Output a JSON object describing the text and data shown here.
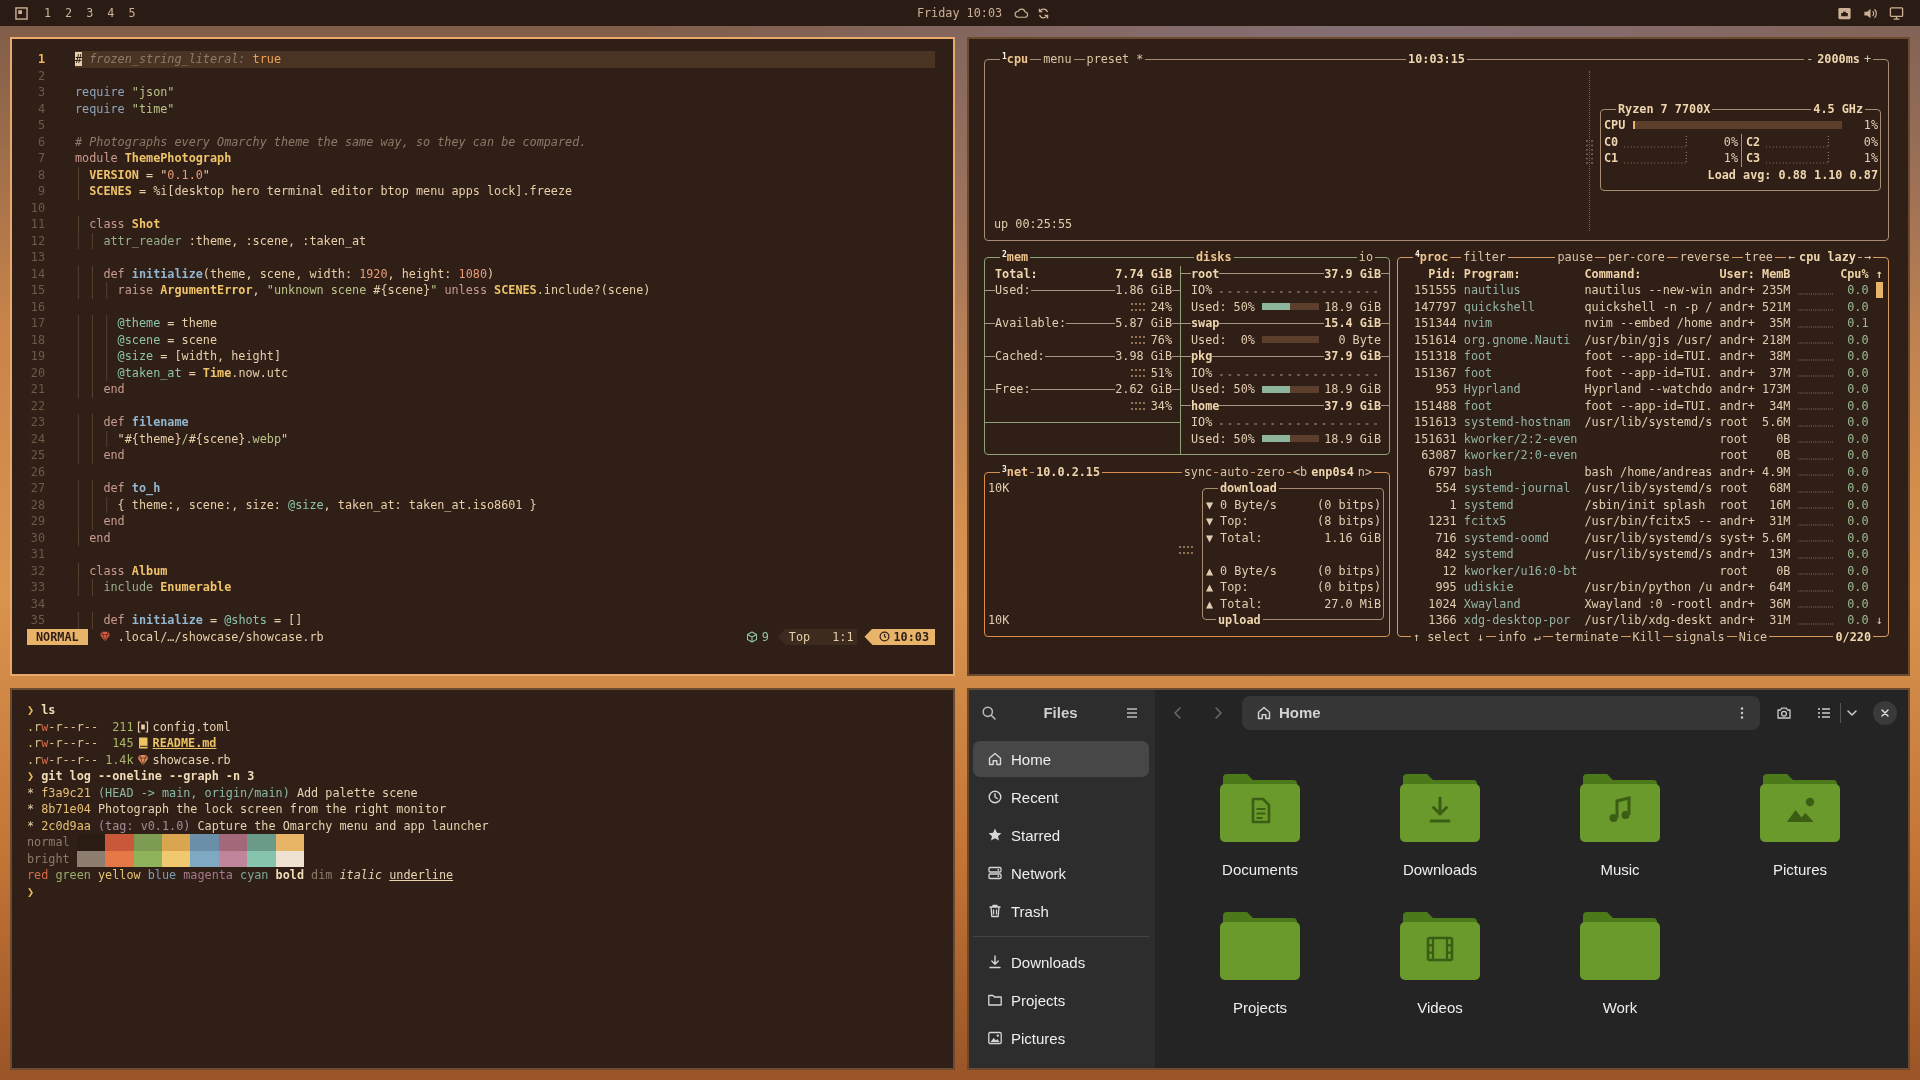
{
  "topbar": {
    "workspaces": [
      "1",
      "2",
      "3",
      "4",
      "5"
    ],
    "clock": "Friday 10:03"
  },
  "editor": {
    "active": true,
    "lines": [
      {
        "number": "1",
        "current": true,
        "tokens": [
          {
            "kind": "comment",
            "text": "# frozen_string_literal: "
          },
          {
            "kind": "boolean",
            "text": "true"
          }
        ]
      },
      {
        "number": "2",
        "current": false
      },
      {
        "number": "3",
        "current": false,
        "tokens": [
          {
            "kind": "builtin",
            "text": "require "
          },
          {
            "kind": "string",
            "text": "\"json\""
          }
        ]
      },
      {
        "number": "4",
        "current": false,
        "tokens": [
          {
            "kind": "builtin",
            "text": "require "
          },
          {
            "kind": "string",
            "text": "\"time\""
          }
        ]
      },
      {
        "number": "5",
        "current": false
      },
      {
        "number": "6",
        "current": false,
        "tokens": [
          {
            "kind": "comment",
            "text": "# Photographs every Omarchy theme the same way, so they can be compared."
          }
        ]
      },
      {
        "number": "7",
        "current": false,
        "tokens": [
          {
            "kind": "keyword",
            "text": "module "
          },
          {
            "kind": "constant",
            "text": "ThemePhotograph"
          }
        ]
      },
      {
        "number": "8",
        "current": false,
        "tokens": [
          {
            "kind": "constant",
            "text": "  VERSION"
          },
          {
            "kind": "plain",
            "text": " = \""
          },
          {
            "kind": "number",
            "text": "0.1.0"
          },
          {
            "kind": "plain",
            "text": "\""
          }
        ]
      },
      {
        "number": "9",
        "current": false,
        "tokens": [
          {
            "kind": "constant",
            "text": "  SCENES"
          },
          {
            "kind": "plain",
            "text": " = %i[desktop hero terminal editor btop menu apps lock].freeze"
          }
        ]
      },
      {
        "number": "10",
        "current": false
      },
      {
        "number": "11",
        "current": false,
        "tokens": [
          {
            "kind": "keyword",
            "text": "  class "
          },
          {
            "kind": "constant",
            "text": "Shot"
          }
        ]
      },
      {
        "number": "12",
        "current": false,
        "tokens": [
          {
            "kind": "macro",
            "text": "    attr_reader"
          },
          {
            "kind": "plain",
            "text": " :theme, :scene, :taken_at"
          }
        ]
      },
      {
        "number": "13",
        "current": false
      },
      {
        "number": "14",
        "current": false,
        "tokens": [
          {
            "kind": "keyword",
            "text": "    def "
          },
          {
            "kind": "function",
            "text": "initialize"
          },
          {
            "kind": "plain",
            "text": "(theme, scene, width: "
          },
          {
            "kind": "number",
            "text": "1920"
          },
          {
            "kind": "plain",
            "text": ", height: "
          },
          {
            "kind": "number",
            "text": "1080"
          },
          {
            "kind": "plain",
            "text": ")"
          }
        ]
      },
      {
        "number": "15",
        "current": false,
        "tokens": [
          {
            "kind": "keyword",
            "text": "      raise "
          },
          {
            "kind": "constant",
            "text": "ArgumentError"
          },
          {
            "kind": "plain",
            "text": ", "
          },
          {
            "kind": "string",
            "text": "\"unknown scene "
          },
          {
            "kind": "plain",
            "text": "#{scene}"
          },
          {
            "kind": "string",
            "text": "\""
          },
          {
            "kind": "keyword",
            "text": " unless "
          },
          {
            "kind": "constant",
            "text": "SCENES"
          },
          {
            "kind": "plain",
            "text": ".include?(scene)"
          }
        ]
      },
      {
        "number": "16",
        "current": false
      },
      {
        "number": "17",
        "current": false,
        "tokens": [
          {
            "kind": "ivar",
            "text": "      @theme"
          },
          {
            "kind": "plain",
            "text": " = theme"
          }
        ]
      },
      {
        "number": "18",
        "current": false,
        "tokens": [
          {
            "kind": "ivar",
            "text": "      @scene"
          },
          {
            "kind": "plain",
            "text": " = scene"
          }
        ]
      },
      {
        "number": "19",
        "current": false,
        "tokens": [
          {
            "kind": "ivar",
            "text": "      @size"
          },
          {
            "kind": "plain",
            "text": " = [width, height]"
          }
        ]
      },
      {
        "number": "20",
        "current": false,
        "tokens": [
          {
            "kind": "ivar",
            "text": "      @taken_at"
          },
          {
            "kind": "plain",
            "text": " = "
          },
          {
            "kind": "constant",
            "text": "Time"
          },
          {
            "kind": "plain",
            "text": ".now.utc"
          }
        ]
      },
      {
        "number": "21",
        "current": false,
        "tokens": [
          {
            "kind": "keyword",
            "text": "    end"
          }
        ]
      },
      {
        "number": "22",
        "current": false
      },
      {
        "number": "23",
        "current": false,
        "tokens": [
          {
            "kind": "keyword",
            "text": "    def "
          },
          {
            "kind": "function",
            "text": "filename"
          }
        ]
      },
      {
        "number": "24",
        "current": false,
        "tokens": [
          {
            "kind": "plain",
            "text": "      \"#{theme}"
          },
          {
            "kind": "string",
            "text": "/"
          },
          {
            "kind": "plain",
            "text": "#{scene}"
          },
          {
            "kind": "string",
            "text": ".webp"
          },
          {
            "kind": "plain",
            "text": "\""
          }
        ]
      },
      {
        "number": "25",
        "current": false,
        "tokens": [
          {
            "kind": "keyword",
            "text": "    end"
          }
        ]
      },
      {
        "number": "26",
        "current": false
      },
      {
        "number": "27",
        "current": false,
        "tokens": [
          {
            "kind": "keyword",
            "text": "    def "
          },
          {
            "kind": "function",
            "text": "to_h"
          }
        ]
      },
      {
        "number": "28",
        "current": false,
        "tokens": [
          {
            "kind": "plain",
            "text": "      { theme:, scene:, size: "
          },
          {
            "kind": "ivar",
            "text": "@size"
          },
          {
            "kind": "plain",
            "text": ", taken_at: taken_at.iso8601 }"
          }
        ]
      },
      {
        "number": "29",
        "current": false,
        "tokens": [
          {
            "kind": "keyword",
            "text": "    end"
          }
        ]
      },
      {
        "number": "30",
        "current": false,
        "tokens": [
          {
            "kind": "keyword",
            "text": "  end"
          }
        ]
      },
      {
        "number": "31",
        "current": false
      },
      {
        "number": "32",
        "current": false,
        "tokens": [
          {
            "kind": "keyword",
            "text": "  class "
          },
          {
            "kind": "constant",
            "text": "Album"
          }
        ]
      },
      {
        "number": "33",
        "current": false,
        "tokens": [
          {
            "kind": "macro",
            "text": "    include "
          },
          {
            "kind": "constant",
            "text": "Enumerable"
          }
        ]
      },
      {
        "number": "34",
        "current": false
      },
      {
        "number": "35",
        "current": false,
        "tokens": [
          {
            "kind": "keyword",
            "text": "    def "
          },
          {
            "kind": "function",
            "text": "initialize"
          },
          {
            "kind": "plain",
            "text": " = "
          },
          {
            "kind": "ivar",
            "text": "@shots"
          },
          {
            "kind": "plain",
            "text": " = []"
          }
        ]
      }
    ],
    "status": {
      "mode": "NORMAL",
      "path": ".local/…/showcase/showcase.rb",
      "diagnostics": "9",
      "scroll": "Top",
      "position": "1:1",
      "time": "10:03"
    }
  },
  "btop": {
    "active": false,
    "cpu": {
      "title": "$^{1}$cpu",
      "buttons": [
        "menu",
        "preset *"
      ],
      "clock": "10:03:15",
      "interval": {
        "decrease": "-",
        "value": "2000ms",
        "increase": "+"
      },
      "uptime": "up 00:25:55",
      "processor": {
        "name": "Ryzen 7 7700X",
        "frequency": "4.5 GHz",
        "total": {
          "label": "CPU",
          "level": 0.01,
          "reading": "1%"
        },
        "cores": [
          {
            "label": "C0",
            "reading": "0%"
          },
          {
            "label": "C2",
            "reading": "0%"
          },
          {
            "label": "C1",
            "reading": "1%"
          },
          {
            "label": "C3",
            "reading": "1%"
          }
        ],
        "load": "Load avg: 0.88 1.10 0.87"
      }
    },
    "memory": {
      "title": "$^{2}$mem",
      "rows": [
        {
          "kind": "total",
          "label": "Total:",
          "value": "7.74 GiB"
        },
        {
          "kind": "stat",
          "label": "Used:",
          "value": "1.86 GiB"
        },
        {
          "kind": "percent",
          "value": "24%"
        },
        {
          "kind": "stat",
          "label": "Available:",
          "value": "5.87 GiB"
        },
        {
          "kind": "percent",
          "value": "76%"
        },
        {
          "kind": "stat",
          "label": "Cached:",
          "value": "3.98 GiB"
        },
        {
          "kind": "percent",
          "value": "51%"
        },
        {
          "kind": "stat",
          "label": "Free:",
          "value": "2.62 GiB"
        },
        {
          "kind": "percent",
          "value": "34%"
        }
      ]
    },
    "disks": {
      "title": "disks",
      "io_title": "io",
      "drives": [
        {
          "name": "root",
          "size": "37.9 GiB",
          "io": "IO%",
          "used": "Used: 50%",
          "level": 0.5,
          "amount": "18.9 GiB"
        },
        {
          "name": "swap",
          "size": "15.4 GiB",
          "used": "Used:  0%",
          "amount": "0 Byte"
        },
        {
          "name": "pkg",
          "size": "37.9 GiB",
          "io": "IO%",
          "used": "Used: 50%",
          "level": 0.5,
          "amount": "18.9 GiB"
        },
        {
          "name": "home",
          "size": "37.9 GiB",
          "io": "IO%",
          "used": "Used: 50%",
          "level": 0.5,
          "amount": "18.9 GiB"
        }
      ]
    },
    "network": {
      "title": "$^{3}$net",
      "address": "10.0.2.15",
      "buttons": [
        "sync",
        "auto",
        "zero"
      ],
      "interface": {
        "previous": "<b",
        "name": "enp0s4",
        "next": "n>"
      },
      "scale": [
        "10K",
        "10K"
      ],
      "download": {
        "title": "download",
        "rows": [
          {
            "arrow": "▼",
            "label": "0 Byte/s",
            "value": "(0 bitps)"
          },
          {
            "arrow": "▼",
            "label": "Top:",
            "value": "(8 bitps)"
          },
          {
            "arrow": "▼",
            "label": "Total:",
            "value": "1.16 GiB"
          }
        ]
      },
      "upload": {
        "title": "upload",
        "rows": [
          {
            "arrow": "▲",
            "label": "0 Byte/s",
            "value": "(0 bitps)"
          },
          {
            "arrow": "▲",
            "label": "Top:",
            "value": "(0 bitps)"
          },
          {
            "arrow": "▲",
            "label": "Total:",
            "value": "27.0 MiB"
          }
        ]
      }
    },
    "processes": {
      "title": "$^{4}$proc",
      "filter": "filter",
      "toggles": [
        "pause",
        "per-core",
        "reverse",
        "tree"
      ],
      "sort": {
        "previous": "←",
        "name": "cpu lazy",
        "next": "→"
      },
      "columns": [
        "Pid:",
        "Program:",
        "Command:",
        "User:",
        "MemB",
        "Cpu%"
      ],
      "scroll_up": "↑",
      "scroll_down": "↓",
      "rows": [
        {
          "pid": "151555",
          "program": "nautilus",
          "command": "nautilus --new-win",
          "user": "andr+",
          "memory": "235M",
          "cpu": "0.0"
        },
        {
          "pid": "147797",
          "program": "quickshell",
          "command": "quickshell -n -p /",
          "user": "andr+",
          "memory": "521M",
          "cpu": "0.0"
        },
        {
          "pid": "151344",
          "program": "nvim",
          "command": "nvim --embed /home",
          "user": "andr+",
          "memory": "35M",
          "cpu": "0.1"
        },
        {
          "pid": "151614",
          "program": "org.gnome.Nauti",
          "command": "/usr/bin/gjs /usr/",
          "user": "andr+",
          "memory": "218M",
          "cpu": "0.0"
        },
        {
          "pid": "151318",
          "program": "foot",
          "command": "foot --app-id=TUI.",
          "user": "andr+",
          "memory": "38M",
          "cpu": "0.0"
        },
        {
          "pid": "151367",
          "program": "foot",
          "command": "foot --app-id=TUI.",
          "user": "andr+",
          "memory": "37M",
          "cpu": "0.0"
        },
        {
          "pid": "953",
          "program": "Hyprland",
          "command": "Hyprland --watchdo",
          "user": "andr+",
          "memory": "173M",
          "cpu": "0.0"
        },
        {
          "pid": "151488",
          "program": "foot",
          "command": "foot --app-id=TUI.",
          "user": "andr+",
          "memory": "34M",
          "cpu": "0.0"
        },
        {
          "pid": "151613",
          "program": "systemd-hostnam",
          "command": "/usr/lib/systemd/s",
          "user": "root",
          "memory": "5.6M",
          "cpu": "0.0"
        },
        {
          "pid": "151631",
          "program": "kworker/2:2-even",
          "user": "root",
          "memory": "0B",
          "cpu": "0.0"
        },
        {
          "pid": "63087",
          "program": "kworker/2:0-even",
          "user": "root",
          "memory": "0B",
          "cpu": "0.0"
        },
        {
          "pid": "6797",
          "program": "bash",
          "command": "bash /home/andreas",
          "user": "andr+",
          "memory": "4.9M",
          "cpu": "0.0"
        },
        {
          "pid": "554",
          "program": "systemd-journal",
          "command": "/usr/lib/systemd/s",
          "user": "root",
          "memory": "68M",
          "cpu": "0.0"
        },
        {
          "pid": "1",
          "program": "systemd",
          "command": "/sbin/init splash",
          "user": "root",
          "memory": "16M",
          "cpu": "0.0"
        },
        {
          "pid": "1231",
          "program": "fcitx5",
          "command": "/usr/bin/fcitx5 --",
          "user": "andr+",
          "memory": "31M",
          "cpu": "0.0"
        },
        {
          "pid": "716",
          "program": "systemd-oomd",
          "command": "/usr/lib/systemd/s",
          "user": "syst+",
          "memory": "5.6M",
          "cpu": "0.0"
        },
        {
          "pid": "842",
          "program": "systemd",
          "command": "/usr/lib/systemd/s",
          "user": "andr+",
          "memory": "13M",
          "cpu": "0.0"
        },
        {
          "pid": "12",
          "program": "kworker/u16:0-bt",
          "user": "root",
          "memory": "0B",
          "cpu": "0.0"
        },
        {
          "pid": "995",
          "program": "udiskie",
          "command": "/usr/bin/python /u",
          "user": "andr+",
          "memory": "64M",
          "cpu": "0.0"
        },
        {
          "pid": "1024",
          "program": "Xwayland",
          "command": "Xwayland :0 -rootl",
          "user": "andr+",
          "memory": "36M",
          "cpu": "0.0"
        },
        {
          "pid": "1366",
          "program": "xdg-desktop-por",
          "command": "/usr/lib/xdg-deskt",
          "user": "andr+",
          "memory": "31M",
          "cpu": "0.0"
        }
      ],
      "footer": [
        "↑ select ↓",
        "info ↵",
        "terminate",
        "Kill",
        "signals",
        "Nice"
      ],
      "count": "0/220"
    }
  },
  "terminal": {
    "active": false,
    "lines": [
      {
        "kind": "command",
        "prompt": "❯",
        "command": "ls"
      },
      {
        "kind": "file",
        "permissions": [
          {
            "kind": "plain",
            "text": ".r"
          },
          {
            "kind": "write",
            "text": "w"
          },
          {
            "kind": "plain",
            "text": "-r--r--"
          }
        ],
        "size": "211",
        "file": {
          "kind": "toml",
          "name": "config.toml",
          "highlighted": false
        }
      },
      {
        "kind": "file",
        "permissions": [
          {
            "kind": "plain",
            "text": ".r"
          },
          {
            "kind": "write",
            "text": "w"
          },
          {
            "kind": "plain",
            "text": "-r--r--"
          }
        ],
        "size": "145",
        "file": {
          "kind": "markdown",
          "name": "README.md",
          "highlighted": true
        }
      },
      {
        "kind": "file",
        "permissions": [
          {
            "kind": "plain",
            "text": ".r"
          },
          {
            "kind": "write",
            "text": "w"
          },
          {
            "kind": "plain",
            "text": "-r--r--"
          }
        ],
        "size": "1.4k",
        "file": {
          "kind": "ruby",
          "name": "showcase.rb",
          "highlighted": false
        }
      },
      {
        "kind": "command",
        "prompt": "❯",
        "command": "git log --oneline --graph -n 3"
      },
      {
        "kind": "commit",
        "graph": "*",
        "hash": "f3a9c21",
        "refs": {
          "kind": "branch",
          "text": "(HEAD -> main, origin/main)"
        },
        "message": "Add palette scene"
      },
      {
        "kind": "commit",
        "graph": "*",
        "hash": "8b71e04",
        "message": "Photograph the lock screen from the right monitor"
      },
      {
        "kind": "commit",
        "graph": "*",
        "hash": "2c0d9aa",
        "refs": {
          "kind": "tag",
          "text": "(tag: v0.1.0)"
        },
        "message": "Capture the Omarchy menu and app launcher"
      },
      {
        "kind": "palette",
        "label": "normal",
        "swatches": [
          {
            "color": "#2a1b13"
          },
          {
            "color": "#c9573a"
          },
          {
            "color": "#7d9b52"
          },
          {
            "color": "#d9a54e"
          },
          {
            "color": "#6b8fa8"
          },
          {
            "color": "#a3697b"
          },
          {
            "color": "#6a9a88"
          },
          {
            "color": "#e8b466"
          }
        ]
      },
      {
        "kind": "palette",
        "label": "bright",
        "swatches": [
          {
            "color": "#8d7d6f"
          },
          {
            "color": "#e67848"
          },
          {
            "color": "#8eb35a"
          },
          {
            "color": "#f0c870"
          },
          {
            "color": "#7fa8c2"
          },
          {
            "color": "#c0859a"
          },
          {
            "color": "#86c4ae"
          },
          {
            "color": "#efe2d2"
          }
        ]
      },
      {
        "kind": "styles",
        "words": [
          {
            "kind": "red",
            "text": "red"
          },
          {
            "kind": "green",
            "text": "green"
          },
          {
            "kind": "yellow",
            "text": "yellow"
          },
          {
            "kind": "blue",
            "text": "blue"
          },
          {
            "kind": "magenta",
            "text": "magenta"
          },
          {
            "kind": "cyan",
            "text": "cyan"
          },
          {
            "kind": "bold",
            "text": "bold"
          },
          {
            "kind": "dim",
            "text": "dim"
          },
          {
            "kind": "italic",
            "text": "italic"
          },
          {
            "kind": "underline",
            "text": "underline"
          }
        ]
      },
      {
        "kind": "prompt",
        "prompt": "❯"
      }
    ]
  },
  "files": {
    "active": false,
    "title": "Files",
    "sidebar": {
      "places": [
        {
          "kind": "home",
          "label": "Home",
          "selected": true
        },
        {
          "kind": "recent",
          "label": "Recent",
          "selected": false
        },
        {
          "kind": "starred",
          "label": "Starred",
          "selected": false
        },
        {
          "kind": "network",
          "label": "Network",
          "selected": false
        },
        {
          "kind": "trash",
          "label": "Trash",
          "selected": false
        }
      ],
      "bookmarks": [
        {
          "kind": "downloads",
          "label": "Downloads",
          "selected": false
        },
        {
          "kind": "folder",
          "label": "Projects",
          "selected": false
        },
        {
          "kind": "pictures",
          "label": "Pictures",
          "selected": false
        }
      ]
    },
    "navigation": [
      {
        "kind": "back",
        "disabled": true
      },
      {
        "kind": "forward",
        "disabled": true
      }
    ],
    "location": "Home",
    "folders": [
      {
        "kind": "documents",
        "name": "Documents",
        "selected": false
      },
      {
        "kind": "downloads",
        "name": "Downloads",
        "selected": false
      },
      {
        "kind": "music",
        "name": "Music",
        "selected": false
      },
      {
        "kind": "pictures",
        "name": "Pictures",
        "selected": false
      },
      {
        "kind": "plain",
        "name": "Projects",
        "selected": false
      },
      {
        "kind": "videos",
        "name": "Videos",
        "selected": false
      },
      {
        "kind": "plain",
        "name": "Work",
        "selected": false
      }
    ]
  }
}
